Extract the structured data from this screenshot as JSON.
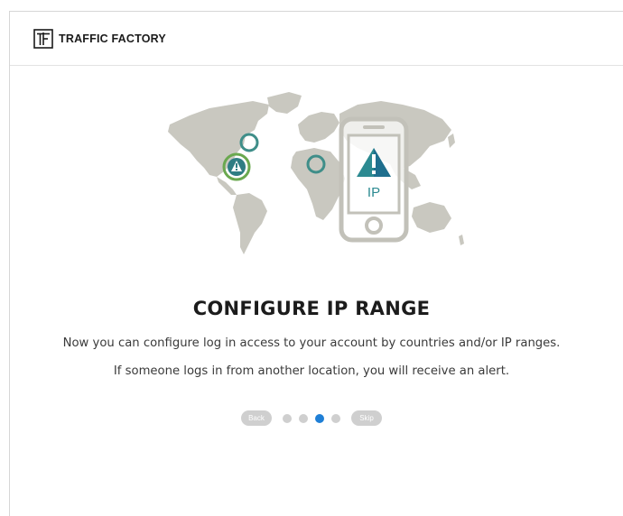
{
  "header": {
    "brand_name": "TRAFFIC FACTORY",
    "logo_letters": "TF"
  },
  "illustration": {
    "phone_label": "IP",
    "alert_glyph": "!",
    "icons": [
      "world-map",
      "phone-icon",
      "alert-triangle-icon",
      "location-ring-icon"
    ]
  },
  "onboarding": {
    "title": "CONFIGURE IP RANGE",
    "description_line1": "Now you can configure log in access to your account by countries and/or IP ranges.",
    "description_line2": "If someone logs in from another location, you will receive an alert.",
    "back_label": "Back",
    "skip_label": "Skip",
    "total_steps": 4,
    "current_step": 3
  },
  "colors": {
    "accent_blue": "#1f7fd6",
    "pill_gray": "#cfcfcf",
    "map_gray": "#c9c8c0",
    "ring_teal": "#3f8e89",
    "ring_green": "#6aa84f",
    "alert_teal": "#2c8a91"
  }
}
